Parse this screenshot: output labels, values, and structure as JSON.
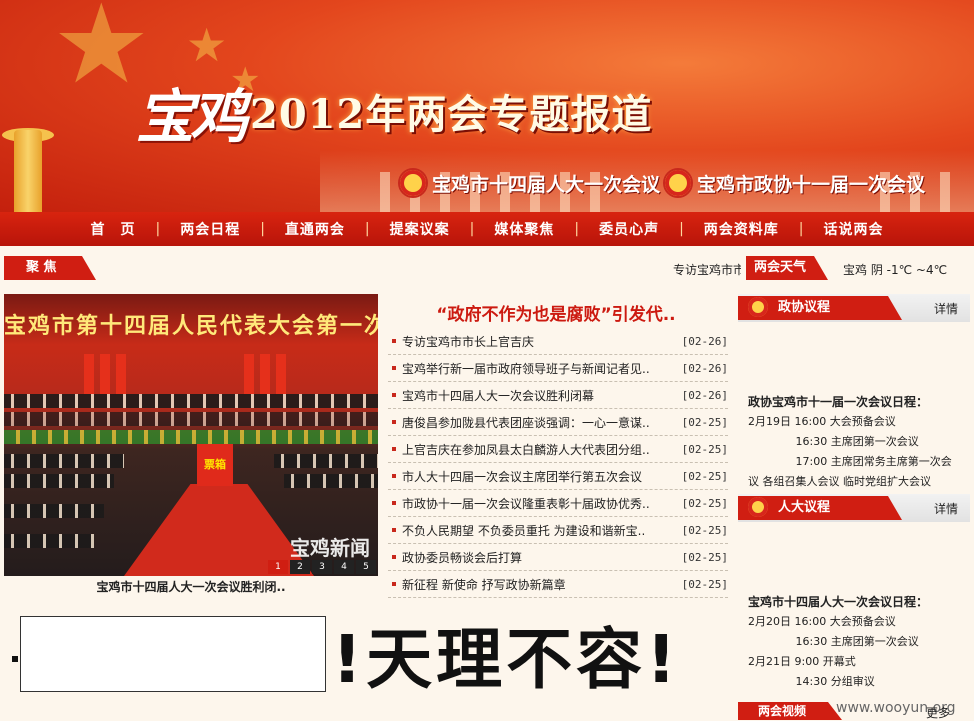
{
  "banner": {
    "logo": "宝鸡",
    "title": "2012年两会专题报道",
    "meeting_left": "宝鸡市十四届人大一次会议",
    "meeting_right": "宝鸡市政协十一届一次会议"
  },
  "nav": {
    "items": [
      "首　页",
      "两会日程",
      "直通两会",
      "提案议案",
      "媒体聚焦",
      "委员心声",
      "两会资料库",
      "话说两会"
    ]
  },
  "focus": {
    "label": "聚 焦",
    "ticker": "专访宝鸡市市长"
  },
  "weather": {
    "label": "两会天气",
    "text": "宝鸡  阴  -1℃  ~4℃"
  },
  "photo": {
    "title": "宝鸡市第十四届人民代表大会第一次",
    "ballot": "票箱",
    "watermark": "宝鸡新闻",
    "caption": "宝鸡市十四届人大一次会议胜利闭..",
    "pages": [
      "1",
      "2",
      "3",
      "4",
      "5"
    ]
  },
  "headline": "“政府不作为也是腐败”引发代..",
  "news": [
    {
      "title": "专访宝鸡市市长上官吉庆",
      "date": "[02-26]"
    },
    {
      "title": "宝鸡举行新一届市政府领导班子与新闻记者见..",
      "date": "[02-26]"
    },
    {
      "title": "宝鸡市十四届人大一次会议胜利闭幕",
      "date": "[02-26]"
    },
    {
      "title": "唐俊昌参加陇县代表团座谈强调：一心一意谋..",
      "date": "[02-25]"
    },
    {
      "title": "上官吉庆在参加凤县太白麟游人大代表团分组..",
      "date": "[02-25]"
    },
    {
      "title": "市人大十四届一次会议主席团举行第五次会议",
      "date": "[02-25]"
    },
    {
      "title": "市政协十一届一次会议隆重表彰十届政协优秀..",
      "date": "[02-25]"
    },
    {
      "title": "不负人民期望 不负委员重托 为建设和谐新宝..",
      "date": "[02-25]"
    },
    {
      "title": "政协委员畅谈会后打算",
      "date": "[02-25]"
    },
    {
      "title": "新征程 新使命 抒写政协新篇章",
      "date": "[02-25]"
    }
  ],
  "cppcc": {
    "label": "政协议程",
    "more": "详情",
    "heading": "政协宝鸡市十一届一次会议日程：",
    "lines": [
      "2月19日  16:00  大会预备会议",
      "　　　　  16:30  主席团第一次会议",
      "　　　　  17:00  主席团常务主席第一次会",
      "议  各组召集人会议  临时党组扩大会议"
    ]
  },
  "npc": {
    "label": "人大议程",
    "more": "详情",
    "heading": "宝鸡市十四届人大一次会议日程：",
    "lines": [
      "2月20日  16:00  大会预备会议",
      "　　　　  16:30  主席团第一次会议",
      "2月21日  9:00  开幕式",
      "　　　　  14:30  分组审议"
    ]
  },
  "slogan": "!天理不容!",
  "video": {
    "label": "两会视频",
    "more": "更多"
  },
  "site_watermark": "www.wooyun.org",
  "colors": {
    "brand_red": "#d01e12",
    "headline_red": "#cc1a10",
    "banner_gold": "#ffd24a"
  }
}
